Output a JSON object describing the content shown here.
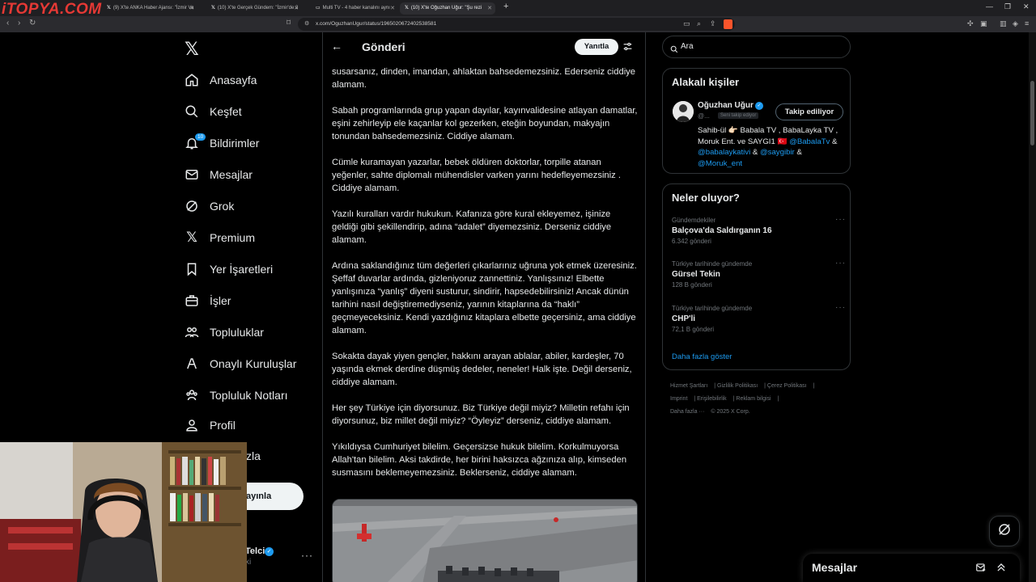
{
  "browser": {
    "logo_text": "iTOPYA.COM",
    "tabs": [
      {
        "label": "(9) X'te ANKA Haber Ajansı: \"İzmir Va",
        "active": false
      },
      {
        "label": "(10) X'te Gerçek Gündem: \"İzmir'de 3",
        "active": false
      },
      {
        "label": "Multi TV - 4 haber kanalını aynı",
        "active": false
      },
      {
        "label": "(10) X'te Oğuzhan Uğur: \"Şu rezi",
        "active": true
      }
    ],
    "url": "x.com/OguzhanUgur/status/1965020672402538581"
  },
  "sidebar": {
    "notification_count": "10",
    "items": [
      {
        "label": "Anasayfa",
        "icon": "home-icon"
      },
      {
        "label": "Keşfet",
        "icon": "search-icon"
      },
      {
        "label": "Bildirimler",
        "icon": "bell-icon"
      },
      {
        "label": "Mesajlar",
        "icon": "mail-icon"
      },
      {
        "label": "Grok",
        "icon": "grok-icon"
      },
      {
        "label": "Premium",
        "icon": "x-icon"
      },
      {
        "label": "Yer İşaretleri",
        "icon": "bookmark-icon"
      },
      {
        "label": "İşler",
        "icon": "briefcase-icon"
      },
      {
        "label": "Topluluklar",
        "icon": "communities-icon"
      },
      {
        "label": "Onaylı Kuruluşlar",
        "icon": "verified-org-icon"
      },
      {
        "label": "Topluluk Notları",
        "icon": "community-notes-icon"
      },
      {
        "label": "Profil",
        "icon": "profile-icon"
      }
    ],
    "more_label": "zla",
    "post_label": "ayınla",
    "account_name": "Telci",
    "account_handle": "xi"
  },
  "main": {
    "title": "Gönderi",
    "reply_label": "Yanıtla",
    "paragraphs": [
      "susarsanız, dinden, imandan, ahlaktan bahsedemezsiniz. Ederseniz ciddiye alamam.",
      "Sabah programlarında grup yapan dayılar, kayınvalidesine atlayan damatlar, eşini zehirleyip ele kaçanlar kol gezerken, eteğin boyundan, makyajın tonundan bahsedemezsiniz. Ciddiye alamam.",
      "Cümle kuramayan yazarlar, bebek öldüren doktorlar, torpille atanan yeğenler, sahte diplomalı mühendisler varken yarını hedefleyemezsiniz . Ciddiye alamam.",
      "Yazılı kuralları vardır hukukun. Kafanıza göre kural ekleyemez, işinize geldiği gibi şekillendirip, adına “adalet” diyemezsiniz. Derseniz ciddiye alamam.",
      "Ardına saklandığınız tüm değerleri çıkarlarınız uğruna yok etmek üzeresiniz. Şeffaf duvarlar ardında, gizleniyoruz zannettiniz. Yanlışsınız! Elbette yanlışınıza “yanlış” diyeni susturur, sindirir, hapsedebilirsiniz! Ancak dünün tarihini nasıl değiştiremediyseniz, yarının kitaplarına da “haklı” geçmeyeceksiniz. Kendi yazdığınız kitaplara elbette geçersiniz, ama ciddiye alamam.",
      "Sokakta dayak yiyen gençler, hakkını arayan ablalar, abiler, kardeşler, 70 yaşında ekmek derdine düşmüş dedeler, neneler! Halk işte. Değil derseniz, ciddiye alamam.",
      "Her şey Türkiye için diyorsunuz. Biz Türkiye değil miyiz? Milletin refahı için diyorsunuz, biz millet değil miyiz? “Öyleyiz” derseniz, ciddiye alamam.",
      "Yıkıldıysa Cumhuriyet bilelim. Geçersizse hukuk bilelim. Korkulmuyorsa Allah'tan bilelim. Aksi takdirde, her birini haksızca ağzınıza alıp, kimseden susmasını beklemeyemezsiniz. Beklerseniz, ciddiye alamam."
    ]
  },
  "right": {
    "search_placeholder": "Ara",
    "related_title": "Alakalı kişiler",
    "related": {
      "name": "Oğuzhan Uğur",
      "handle": "@...",
      "follows_you": "Seni takip ediyor",
      "follow_label": "Takip ediliyor",
      "bio_plain_1": "Sahib-ül 👉🏻 Babala TV , BabaLayka TV , Moruk Ent. ve SAYGI1 🇹🇷 ",
      "bio_m1": "@BabalaTv",
      "bio_amp1": " & ",
      "bio_m2": "@babalaykativi",
      "bio_amp2": " & ",
      "bio_m3": "@saygibir",
      "bio_amp3": " & ",
      "bio_m4": "@Moruk_ent"
    },
    "trends_title": "Neler oluyor?",
    "trends": [
      {
        "context": "Gündemdekiler",
        "name": "Balçova'da Saldırganın 16",
        "count": "6.342 gönderi"
      },
      {
        "context": "Türkiye tarihinde gündemde",
        "name": "Gürsel Tekin",
        "count": "128 B gönderi"
      },
      {
        "context": "Türkiye tarihinde gündemde",
        "name": "CHP'li",
        "count": "72,1 B gönderi"
      }
    ],
    "show_more": "Daha fazla göster",
    "footer": [
      "Hizmet Şartları",
      "Gizlilik Politikası",
      "Çerez Politikası",
      "Imprint",
      "Erişilebilirlik",
      "Reklam bilgisi",
      "Daha fazla ···",
      "© 2025 X Corp."
    ]
  },
  "messages": {
    "title": "Mesajlar"
  }
}
